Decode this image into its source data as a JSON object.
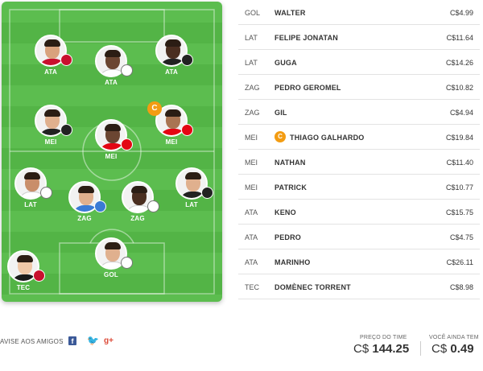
{
  "colors": {
    "field_green": "#5cbd4f",
    "captain_orange": "#f39c12",
    "flamengo": "#c8102e",
    "atletico": "#222222",
    "santos": "#ffffff",
    "internacional": "#e30613",
    "gremio": "#3a7bd5",
    "corinthians": "#ffffff"
  },
  "field": {
    "players": [
      {
        "name": "ATA",
        "label": "ATA",
        "club": "flamengo",
        "skin": "#d9a27d",
        "shirt": "#c8102e",
        "captain": false
      },
      {
        "name": "ATA2",
        "label": "ATA",
        "club": "santos",
        "skin": "#6b4632",
        "shirt": "#ffffff",
        "captain": false
      },
      {
        "name": "ATA3",
        "label": "ATA",
        "club": "atletico",
        "skin": "#4a2e20",
        "shirt": "#222222",
        "captain": false
      },
      {
        "name": "MEI1",
        "label": "MEI",
        "club": "atletico",
        "skin": "#e0b08e",
        "shirt": "#222222",
        "captain": false
      },
      {
        "name": "MEI2",
        "label": "MEI",
        "club": "internacional",
        "skin": "#6b4632",
        "shirt": "#e30613",
        "captain": false
      },
      {
        "name": "MEI3",
        "label": "MEI",
        "club": "internacional",
        "skin": "#a97452",
        "shirt": "#e30613",
        "captain": true
      },
      {
        "name": "LAT1",
        "label": "LAT",
        "club": "santos",
        "skin": "#c98e6a",
        "shirt": "#ffffff",
        "captain": false
      },
      {
        "name": "ZAG1",
        "label": "ZAG",
        "club": "gremio",
        "skin": "#e0b08e",
        "shirt": "#3a7bd5",
        "captain": false
      },
      {
        "name": "ZAG2",
        "label": "ZAG",
        "club": "corinthians",
        "skin": "#4a2e20",
        "shirt": "#ffffff",
        "captain": false
      },
      {
        "name": "LAT2",
        "label": "LAT",
        "club": "atletico",
        "skin": "#e0b08e",
        "shirt": "#222222",
        "captain": false
      },
      {
        "name": "GOL",
        "label": "GOL",
        "club": "corinthians",
        "skin": "#e0b08e",
        "shirt": "#ffffff",
        "captain": false
      },
      {
        "name": "TEC",
        "label": "TEC",
        "club": "flamengo",
        "skin": "#f0c8a8",
        "shirt": "#1a1a1a",
        "captain": false
      }
    ],
    "captain_letter": "C"
  },
  "list": {
    "rows": [
      {
        "pos": "GOL",
        "name": "WALTER",
        "price": "C$4.99",
        "captain": false
      },
      {
        "pos": "LAT",
        "name": "FELIPE JONATAN",
        "price": "C$11.64",
        "captain": false
      },
      {
        "pos": "LAT",
        "name": "GUGA",
        "price": "C$14.26",
        "captain": false
      },
      {
        "pos": "ZAG",
        "name": "PEDRO GEROMEL",
        "price": "C$10.82",
        "captain": false
      },
      {
        "pos": "ZAG",
        "name": "GIL",
        "price": "C$4.94",
        "captain": false
      },
      {
        "pos": "MEI",
        "name": "THIAGO GALHARDO",
        "price": "C$19.84",
        "captain": true
      },
      {
        "pos": "MEI",
        "name": "NATHAN",
        "price": "C$11.40",
        "captain": false
      },
      {
        "pos": "MEI",
        "name": "PATRICK",
        "price": "C$10.77",
        "captain": false
      },
      {
        "pos": "ATA",
        "name": "KENO",
        "price": "C$15.75",
        "captain": false
      },
      {
        "pos": "ATA",
        "name": "PEDRO",
        "price": "C$4.75",
        "captain": false
      },
      {
        "pos": "ATA",
        "name": "MARINHO",
        "price": "C$26.11",
        "captain": false
      },
      {
        "pos": "TEC",
        "name": "DOMÈNEC TORRENT",
        "price": "C$8.98",
        "captain": false
      }
    ]
  },
  "footer": {
    "share_label": "AVISE AOS AMIGOS",
    "facebook_icon": "f",
    "twitter_icon": "🐦",
    "gplus_icon": "g+",
    "team_price_label": "PREÇO DO TIME",
    "team_price_currency": "C$",
    "team_price_value": "144.25",
    "remaining_label": "VOCÊ AINDA TEM",
    "remaining_currency": "C$",
    "remaining_value": "0.49"
  }
}
